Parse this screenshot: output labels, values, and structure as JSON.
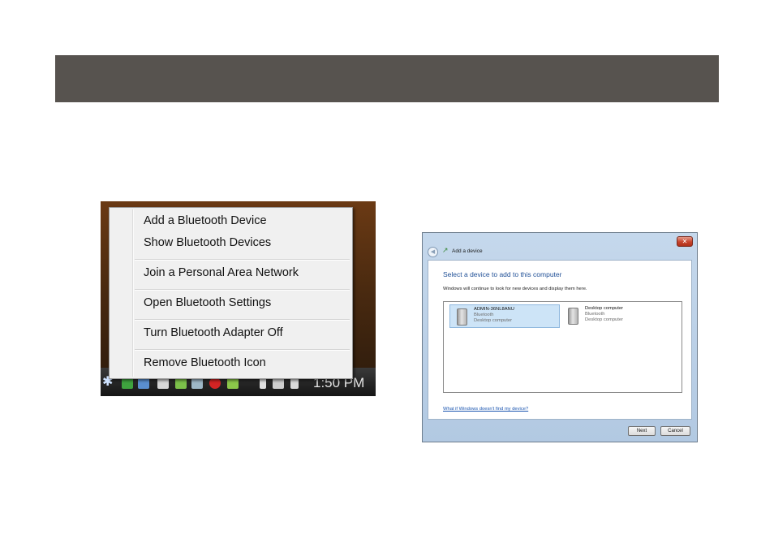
{
  "context_menu": {
    "items": [
      {
        "label": "Add a Bluetooth Device"
      },
      {
        "label": "Show Bluetooth Devices"
      },
      {
        "label": "Join a Personal Area Network"
      },
      {
        "label": "Open Bluetooth Settings"
      },
      {
        "label": "Turn Bluetooth Adapter Off"
      },
      {
        "label": "Remove Bluetooth Icon"
      }
    ]
  },
  "taskbar": {
    "clock": "1:50 PM",
    "bluetooth_glyph": "✱"
  },
  "dialog": {
    "title": "Add a device",
    "close_glyph": "✕",
    "back_glyph": "◀",
    "heading": "Select a device to add to this computer",
    "subtext": "Windows will continue to look for new devices and display them here.",
    "devices": [
      {
        "name": "ADMIN-36NL8ANU",
        "line1": "Bluetooth",
        "line2": "Desktop computer",
        "selected": true
      },
      {
        "name": "Desktop computer",
        "line1": "Bluetooth",
        "line2": "Desktop computer",
        "selected": false
      }
    ],
    "help_link": "What if Windows doesn't find my device?",
    "next_label": "Next",
    "cancel_label": "Cancel"
  },
  "colors": {
    "banner": "#57534f",
    "dialog_heading": "#1f4f96",
    "link": "#1a55b0",
    "selection": "#cde4f7"
  }
}
